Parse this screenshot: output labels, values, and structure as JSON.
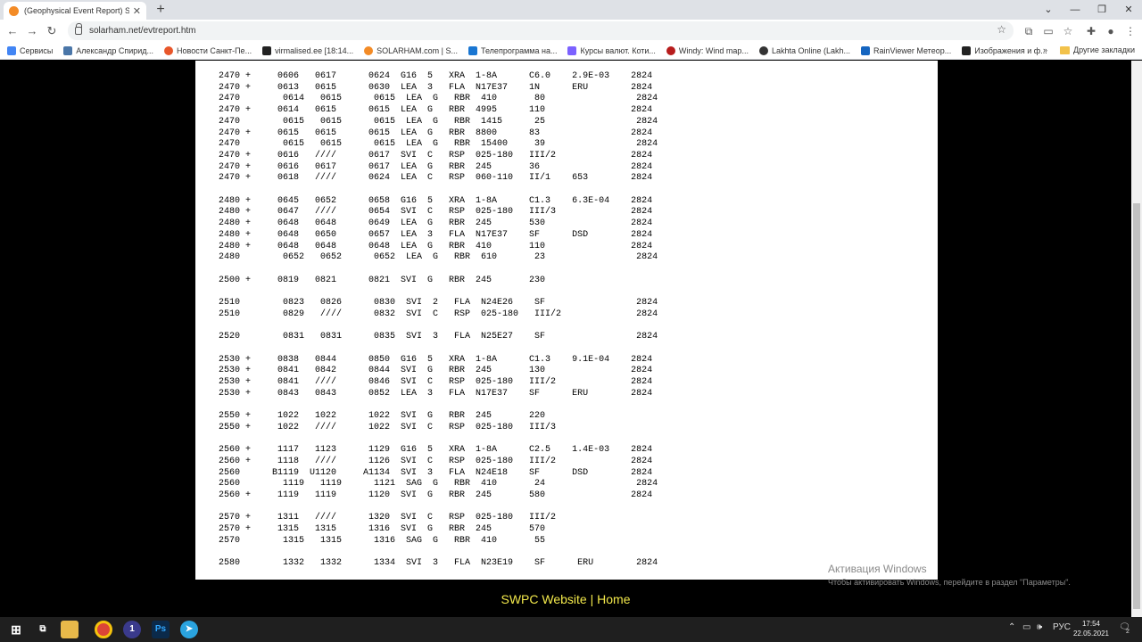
{
  "browser": {
    "tab_title": "(Geophysical Event Report) Space...",
    "tab_close": "✕",
    "new_tab": "+",
    "url": "solarham.net/evtreport.htm"
  },
  "bookmarks": [
    {
      "label": "Сервисы",
      "color": "#4285f4"
    },
    {
      "label": "Александр Спирид...",
      "color": "#4a76a8"
    },
    {
      "label": "Новости Санкт-Пе...",
      "color": "#e8562a"
    },
    {
      "label": "virmalised.ee [18:14...",
      "color": "#222222"
    },
    {
      "label": "SOLARHAM.com | S...",
      "color": "#f38b26"
    },
    {
      "label": "Телепрограмма на...",
      "color": "#1976d2"
    },
    {
      "label": "Курсы валют. Коти...",
      "color": "#7b61ff"
    },
    {
      "label": "Windy: Wind map...",
      "color": "#b71c1c"
    },
    {
      "label": "Lakhta Online (Lakh...",
      "color": "#333333"
    },
    {
      "label": "RainViewer Метеор...",
      "color": "#1565c0"
    },
    {
      "label": "Изображения и ф...",
      "color": "#222222"
    }
  ],
  "bookmarks_more": "»",
  "other_bookmarks": "Другие закладки",
  "report_lines": "2470 +     0606   0617      0624  G16  5   XRA  1-8A      C6.0    2.9E-03    2824\n2470 +     0613   0615      0630  LEA  3   FLA  N17E37    1N      ERU        2824\n2470        0614   0615      0615  LEA  G   RBR  410       80                 2824\n2470 +     0614   0615      0615  LEA  G   RBR  4995      110                2824\n2470        0615   0615      0615  LEA  G   RBR  1415      25                 2824\n2470 +     0615   0615      0615  LEA  G   RBR  8800      83                 2824\n2470        0615   0615      0615  LEA  G   RBR  15400     39                 2824\n2470 +     0616   ////      0617  SVI  C   RSP  025-180   III/2              2824\n2470 +     0616   0617      0617  LEA  G   RBR  245       36                 2824\n2470 +     0618   ////      0624  LEA  C   RSP  060-110   II/1    653        2824\n\n2480 +     0645   0652      0658  G16  5   XRA  1-8A      C1.3    6.3E-04    2824\n2480 +     0647   ////      0654  SVI  C   RSP  025-180   III/3              2824\n2480 +     0648   0648      0649  LEA  G   RBR  245       530                2824\n2480 +     0648   0650      0657  LEA  3   FLA  N17E37    SF      DSD        2824\n2480 +     0648   0648      0648  LEA  G   RBR  410       110                2824\n2480        0652   0652      0652  LEA  G   RBR  610       23                 2824\n\n2500 +     0819   0821      0821  SVI  G   RBR  245       230\n\n2510        0823   0826      0830  SVI  2   FLA  N24E26    SF                 2824\n2510        0829   ////      0832  SVI  C   RSP  025-180   III/2              2824\n\n2520        0831   0831      0835  SVI  3   FLA  N25E27    SF                 2824\n\n2530 +     0838   0844      0850  G16  5   XRA  1-8A      C1.3    9.1E-04    2824\n2530 +     0841   0842      0844  SVI  G   RBR  245       130                2824\n2530 +     0841   ////      0846  SVI  C   RSP  025-180   III/2              2824\n2530 +     0843   0843      0852  LEA  3   FLA  N17E37    SF      ERU        2824\n\n2550 +     1022   1022      1022  SVI  G   RBR  245       220\n2550 +     1022   ////      1022  SVI  C   RSP  025-180   III/3\n\n2560 +     1117   1123      1129  G16  5   XRA  1-8A      C2.5    1.4E-03    2824\n2560 +     1118   ////      1126  SVI  C   RSP  025-180   III/2              2824\n2560      B1119  U1120     A1134  SVI  3   FLA  N24E18    SF      DSD        2824\n2560        1119   1119      1121  SAG  G   RBR  410       24                 2824\n2560 +     1119   1119      1120  SVI  G   RBR  245       580                2824\n\n2570 +     1311   ////      1320  SVI  C   RSP  025-180   III/2\n2570 +     1315   1315      1316  SVI  G   RBR  245       570\n2570        1315   1315      1316  SAG  G   RBR  410       55\n\n2580        1332   1332      1334  SVI  3   FLA  N23E19    SF      ERU        2824",
  "footer": {
    "website": "SWPC Website",
    "separator": " | ",
    "home": "Home"
  },
  "watermark": {
    "title": "Активация Windows",
    "subtitle": "Чтобы активировать Windows, перейдите в раздел \"Параметры\"."
  },
  "taskbar": {
    "lang": "РУС",
    "time": "17:54",
    "date": "22.05.2021",
    "notif_count": "2"
  }
}
